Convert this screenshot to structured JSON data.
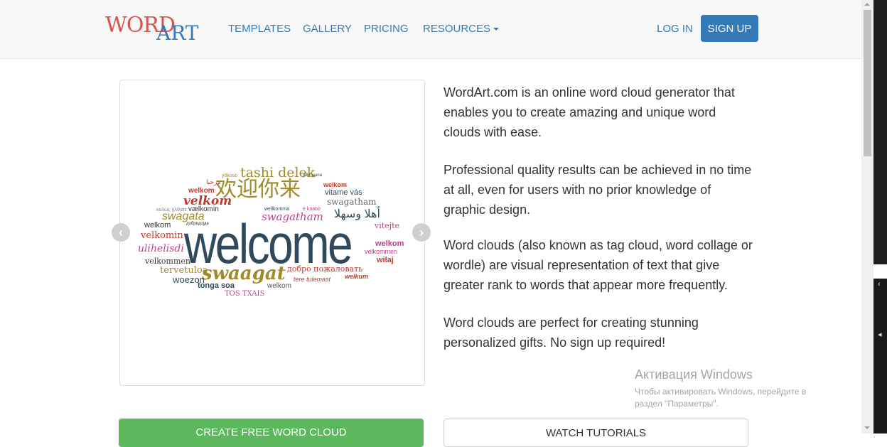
{
  "nav": {
    "logo_part1": "WORD",
    "logo_part2": "ART",
    "templates": "TEMPLATES",
    "gallery": "GALLERY",
    "pricing": "PRICING",
    "resources": "RESOURCES",
    "login": "LOG IN",
    "signup": "SIGN UP"
  },
  "carousel": {
    "prev_icon": "chevron-left-icon",
    "next_icon": "chevron-right-icon",
    "words": {
      "w01": "yōkoso",
      "w02": "tashi delek",
      "w03": "pillo jaana",
      "w04": "مرحبا",
      "w05": "welkom",
      "w06": "欢迎你来",
      "w07": "welkom",
      "w08": "vitame vás",
      "w09": "velkom",
      "w10": "swagatham",
      "w11": "καλώς ήλθατε",
      "w12": "vælkomin",
      "w13": "wellkomma",
      "w14": "ẹ̀ káàbọ̀",
      "w15": "swagata",
      "w16": "swagatham",
      "w17": "أهلا وسهلا",
      "w18": "welkom",
      "w19": "добредојде",
      "w20": "vitejte",
      "w21": "velkomin",
      "w22": "welcome",
      "w23": "welkom",
      "w24": "ulihelisdi",
      "w25": "velkommen",
      "w26": "velkommen",
      "w27": "wilaj",
      "w28": "tervetuloa",
      "w29": "swaagat",
      "w30": "добро пожаловать",
      "w31": "woezon",
      "w32": "tere tulemast",
      "w33": "welkum",
      "w34": "tonga soa",
      "w35": "welkom",
      "w36": "TOS TXAIS"
    }
  },
  "intro": {
    "p1": "WordArt.com is an online word cloud generator that enables you to create amazing and unique word clouds with ease.",
    "p2": "Professional quality results can be achieved in no time at all, even for users with no prior knowledge of graphic design.",
    "p3": "Word clouds (also known as tag cloud, word collage or wordle) are visual representation of text that give greater rank to words that appear more frequently.",
    "p4": "Word clouds are perfect for creating stunning personalized gifts. No sign up required!"
  },
  "actions": {
    "create": "CREATE FREE WORD CLOUD",
    "tutorials": "WATCH TUTORIALS"
  },
  "watermark": {
    "title": "Активация Windows",
    "line1": "Чтобы активировать Windows, перейдите в",
    "line2": "раздел \"Параметры\"."
  },
  "colors": {
    "brand_red": "#d9534f",
    "link_blue": "#337ab7",
    "signup_bg": "#337ab7",
    "create_bg": "#5cb85c",
    "cloud_dark": "#2e4a5c",
    "cloud_gold": "#a08a2a",
    "cloud_pink": "#c0418a",
    "cloud_red": "#c0392b"
  }
}
